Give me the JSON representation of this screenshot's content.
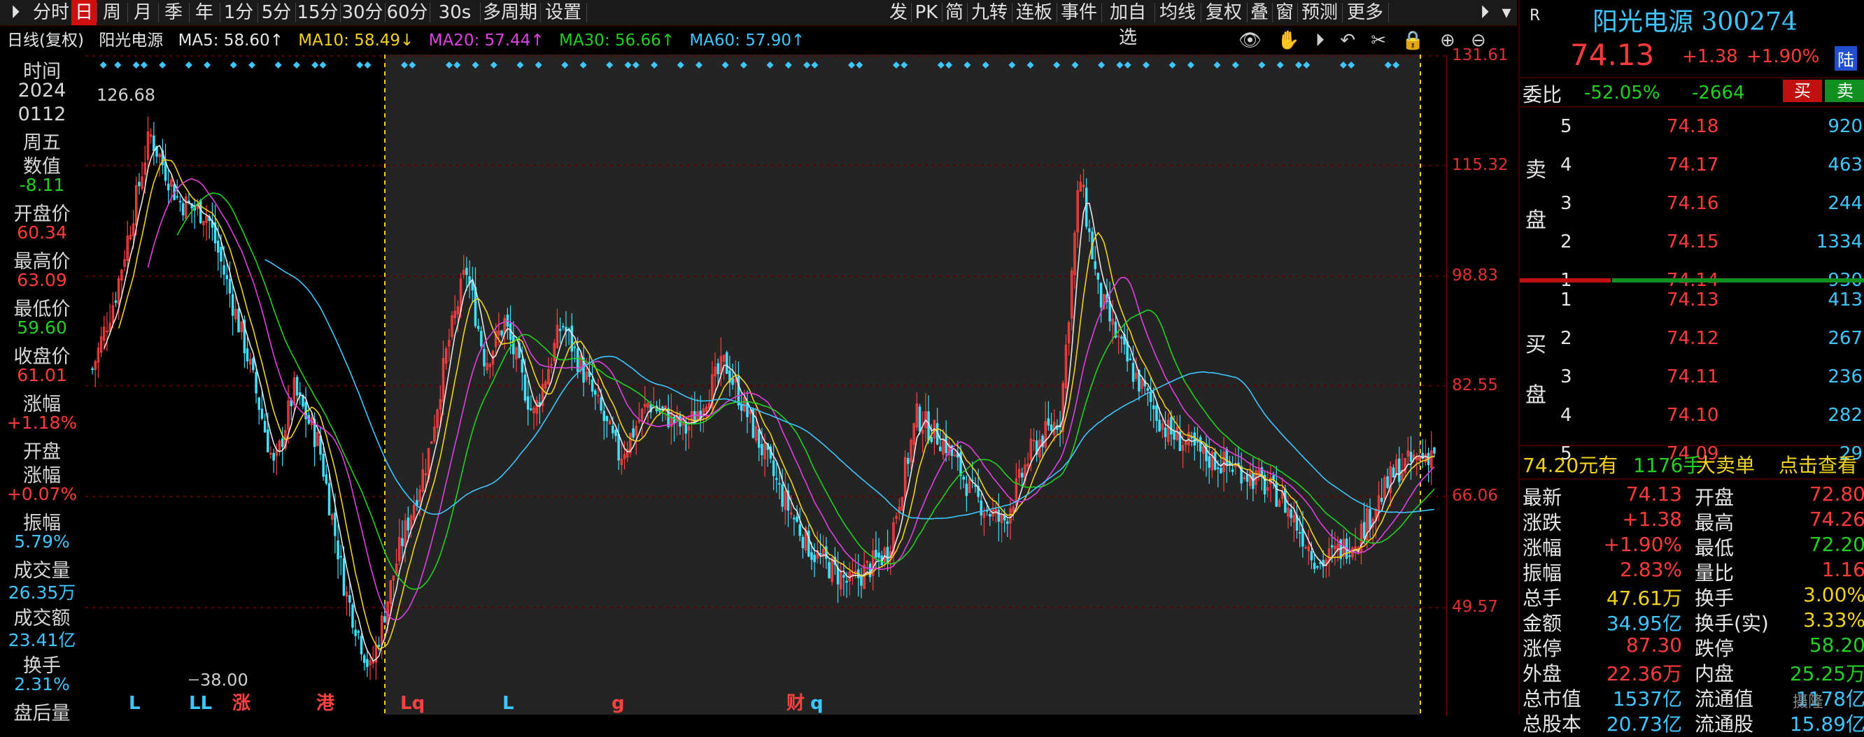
{
  "toolbar": {
    "left_items": [
      "分时",
      "日",
      "周",
      "月",
      "季",
      "年",
      "1分",
      "5分",
      "15分",
      "30分",
      "60分",
      "30s",
      "多周期",
      "设置"
    ],
    "right_items": [
      "发",
      "PK",
      "简",
      "九转",
      "连板",
      "事件",
      "加自选",
      "均线",
      "复权",
      "叠",
      "窗",
      "预测",
      "更多"
    ],
    "active": "日"
  },
  "ma_bar": {
    "period_label": "日线(复权)",
    "stock_name": "阳光电源",
    "ma5": "MA5: 58.60↑",
    "ma10": "MA10: 58.49↓",
    "ma20": "MA20: 57.44↑",
    "ma30": "MA30: 56.66↑",
    "ma60": "MA60: 57.90↑",
    "colors": {
      "ma5": "#e6e6e6",
      "ma10": "#f2d21c",
      "ma20": "#e040e0",
      "ma30": "#21d021",
      "ma60": "#3ec6ff"
    }
  },
  "left_panel": {
    "items": [
      {
        "label": "时间",
        "value": "",
        "color": "#d8d8d8"
      },
      {
        "label": "2024",
        "value": "",
        "color": "#d8d8d8"
      },
      {
        "label": "0112",
        "value": "",
        "color": "#d8d8d8"
      },
      {
        "label": "周五",
        "value": "",
        "color": "#d8d8d8"
      },
      {
        "label": "数值",
        "value": "",
        "color": "#d8d8d8"
      },
      {
        "label": "",
        "value": "-8.11",
        "color": "#21d021"
      },
      {
        "label": "开盘价",
        "value": "",
        "color": "#d8d8d8"
      },
      {
        "label": "",
        "value": "60.34",
        "color": "#ff3a3a"
      },
      {
        "label": "最高价",
        "value": "",
        "color": "#d8d8d8"
      },
      {
        "label": "",
        "value": "63.09",
        "color": "#ff3a3a"
      },
      {
        "label": "最低价",
        "value": "",
        "color": "#d8d8d8"
      },
      {
        "label": "",
        "value": "59.60",
        "color": "#21d021"
      },
      {
        "label": "收盘价",
        "value": "",
        "color": "#d8d8d8"
      },
      {
        "label": "",
        "value": "61.01",
        "color": "#ff3a3a"
      },
      {
        "label": "涨幅",
        "value": "",
        "color": "#d8d8d8"
      },
      {
        "label": "",
        "value": "+1.18%",
        "color": "#ff3a3a"
      },
      {
        "label": "开盘",
        "value": "",
        "color": "#d8d8d8"
      },
      {
        "label": "涨幅",
        "value": "",
        "color": "#d8d8d8"
      },
      {
        "label": "",
        "value": "+0.07%",
        "color": "#ff3a3a"
      },
      {
        "label": "振幅",
        "value": "",
        "color": "#d8d8d8"
      },
      {
        "label": "",
        "value": "5.79%",
        "color": "#3ec6ff"
      },
      {
        "label": "成交量",
        "value": "",
        "color": "#d8d8d8"
      },
      {
        "label": "",
        "value": "26.35万",
        "color": "#3ec6ff"
      },
      {
        "label": "成交额",
        "value": "",
        "color": "#d8d8d8"
      },
      {
        "label": "",
        "value": "23.41亿",
        "color": "#3ec6ff"
      },
      {
        "label": "换手",
        "value": "",
        "color": "#d8d8d8"
      },
      {
        "label": "",
        "value": "2.31%",
        "color": "#3ec6ff"
      },
      {
        "label": "盘后量",
        "value": "",
        "color": "#d8d8d8"
      }
    ]
  },
  "chart_data": {
    "type": "candlestick",
    "y_ticks": [
      "131.61",
      "115.32",
      "98.83",
      "82.55",
      "66.06",
      "49.57"
    ],
    "ylim": [
      38.0,
      131.61
    ],
    "high_label": "126.68",
    "low_label": "38.00",
    "markers": [
      "L",
      "LL",
      "涨",
      "港",
      "Lq",
      "L",
      "g",
      "财",
      "q"
    ],
    "grid": true
  },
  "order_book": {
    "market_tag": "R",
    "name": "阳光电源",
    "code": "300274",
    "price": "74.13",
    "change": "+1.38",
    "change_pct": "+1.90%",
    "exchange_tag": "陆",
    "weibi_label": "委比",
    "weibi_pct": "-52.05%",
    "weibi_num": "-2664",
    "buy_btn": "买",
    "sell_btn": "卖",
    "sell_label": [
      "卖",
      "盘"
    ],
    "buy_label": [
      "买",
      "盘"
    ],
    "asks": [
      {
        "level": "5",
        "price": "74.18",
        "vol": "920"
      },
      {
        "level": "4",
        "price": "74.17",
        "vol": "463"
      },
      {
        "level": "3",
        "price": "74.16",
        "vol": "244"
      },
      {
        "level": "2",
        "price": "74.15",
        "vol": "1334"
      },
      {
        "level": "1",
        "price": "74.14",
        "vol": "930"
      }
    ],
    "bids": [
      {
        "level": "1",
        "price": "74.13",
        "vol": "413"
      },
      {
        "level": "2",
        "price": "74.12",
        "vol": "267"
      },
      {
        "level": "3",
        "price": "74.11",
        "vol": "236"
      },
      {
        "level": "4",
        "price": "74.10",
        "vol": "282"
      },
      {
        "level": "5",
        "price": "74.09",
        "vol": "29"
      }
    ],
    "big_order": {
      "price": "74.20元有",
      "qty": "1176手",
      "label": "大卖单",
      "action": "点击查看"
    },
    "stats": [
      {
        "l1": "最新",
        "v1": "74.13",
        "c1": "#ff3a3a",
        "l2": "开盘",
        "v2": "72.80",
        "c2": "#ff3a3a"
      },
      {
        "l1": "涨跌",
        "v1": "+1.38",
        "c1": "#ff3a3a",
        "l2": "最高",
        "v2": "74.26",
        "c2": "#ff3a3a"
      },
      {
        "l1": "涨幅",
        "v1": "+1.90%",
        "c1": "#ff3a3a",
        "l2": "最低",
        "v2": "72.20",
        "c2": "#21d021"
      },
      {
        "l1": "振幅",
        "v1": "2.83%",
        "c1": "#ff3a3a",
        "l2": "量比",
        "v2": "1.16",
        "c2": "#ff3a3a"
      },
      {
        "l1": "总手",
        "v1": "47.61万",
        "c1": "#f2d21c",
        "l2": "换手",
        "v2": "3.00%",
        "c2": "#f2d21c"
      },
      {
        "l1": "金额",
        "v1": "34.95亿",
        "c1": "#3ec6ff",
        "l2": "换手(实)",
        "v2": "3.33%",
        "c2": "#f2d21c"
      },
      {
        "l1": "涨停",
        "v1": "87.30",
        "c1": "#ff3a3a",
        "l2": "跌停",
        "v2": "58.20",
        "c2": "#21d021"
      },
      {
        "l1": "外盘",
        "v1": "22.36万",
        "c1": "#ff3a3a",
        "l2": "内盘",
        "v2": "25.25万",
        "c2": "#21d021"
      },
      {
        "l1": "总市值",
        "v1": "1537亿",
        "c1": "#3ec6ff",
        "l2": "流通值",
        "v2": "1178亿",
        "c2": "#3ec6ff"
      },
      {
        "l1": "总股本",
        "v1": "20.73亿",
        "c1": "#3ec6ff",
        "l2": "流通股",
        "v2": "15.89亿",
        "c2": "#3ec6ff"
      }
    ]
  },
  "watermark": "摄隆"
}
